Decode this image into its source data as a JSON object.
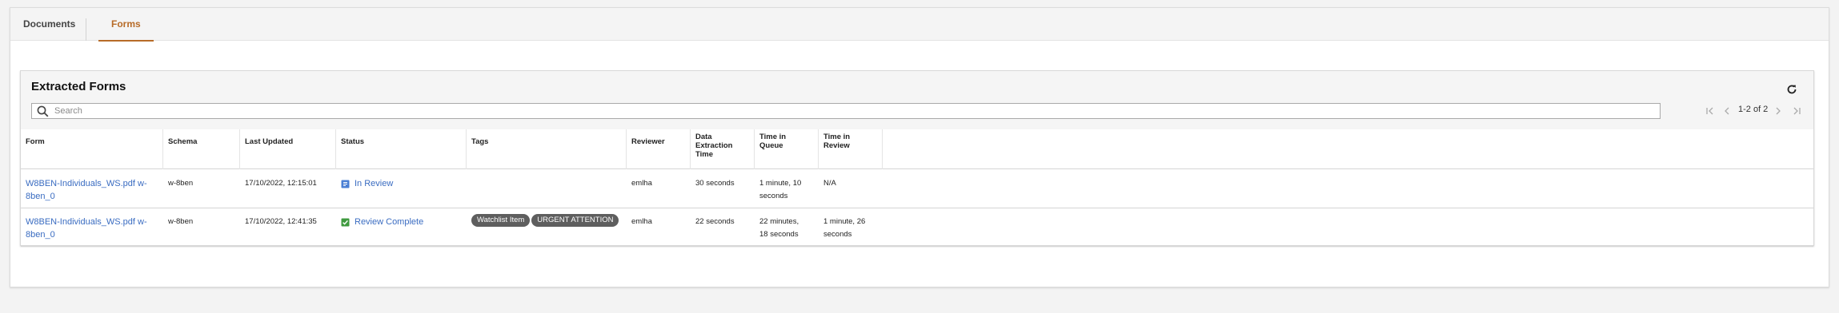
{
  "tabs": [
    {
      "label": "Documents"
    },
    {
      "label": "Forms"
    }
  ],
  "panel": {
    "title": "Extracted Forms",
    "search_placeholder": "Search",
    "pagination": "1-2 of 2"
  },
  "columns": [
    "Form",
    "Schema",
    "Last Updated",
    "Status",
    "Tags",
    "Reviewer",
    "Data Extraction Time",
    "Time in Queue",
    "Time in Review"
  ],
  "rows": [
    {
      "form_line1": "W8BEN-Individuals_WS.pdf w-",
      "form_line2": "8ben_0",
      "schema": "w-8ben",
      "last_updated": "17/10/2022, 12:15:01",
      "status": "In Review",
      "tags": [],
      "reviewer": "emlha",
      "extraction_time": "30 seconds",
      "queue_line1": "1 minute, 10",
      "queue_line2": "seconds",
      "review_line1": "N/A",
      "review_line2": ""
    },
    {
      "form_line1": "W8BEN-Individuals_WS.pdf w-",
      "form_line2": "8ben_0",
      "schema": "w-8ben",
      "last_updated": "17/10/2022, 12:41:35",
      "status": "Review Complete",
      "tags": [
        "Watchlist Item",
        "URGENT ATTENTION"
      ],
      "reviewer": "emlha",
      "extraction_time": "22 seconds",
      "queue_line1": "22 minutes,",
      "queue_line2": "18 seconds",
      "review_line1": "1 minute, 26",
      "review_line2": "seconds"
    }
  ],
  "colors": {
    "accent": "#b76b28",
    "link": "#3a6cc1",
    "in_review_icon": "#4a7fd4",
    "complete_icon": "#3f9a3f",
    "tag_bg": "#5e5e5e"
  },
  "icons": {
    "refresh": "refresh-icon",
    "search": "search-icon",
    "first": "first-page-icon",
    "prev": "prev-page-icon",
    "next": "next-page-icon",
    "last": "last-page-icon",
    "in_review": "clipboard-icon",
    "complete": "check-box-icon"
  }
}
